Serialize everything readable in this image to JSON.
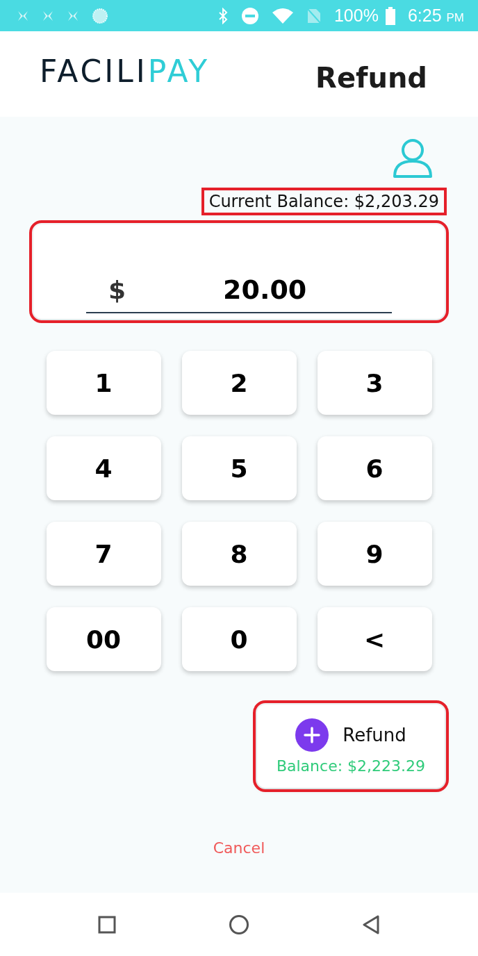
{
  "status_bar": {
    "battery": "100%",
    "time": "6:25",
    "ampm": "PM"
  },
  "header": {
    "logo": {
      "text": "FACILI",
      "accent": "PAY"
    },
    "title": "Refund"
  },
  "balance": {
    "text": "Current Balance: $2,203.29",
    "highlighted": true
  },
  "amount": {
    "currency": "$",
    "value": "20.00",
    "highlighted": true
  },
  "keypad": [
    "1",
    "2",
    "3",
    "4",
    "5",
    "6",
    "7",
    "8",
    "9",
    "00",
    "0",
    "<"
  ],
  "refund_button": {
    "label": "Refund",
    "balance": "Balance: $2,223.29",
    "highlighted": true
  },
  "cancel": "Cancel"
}
